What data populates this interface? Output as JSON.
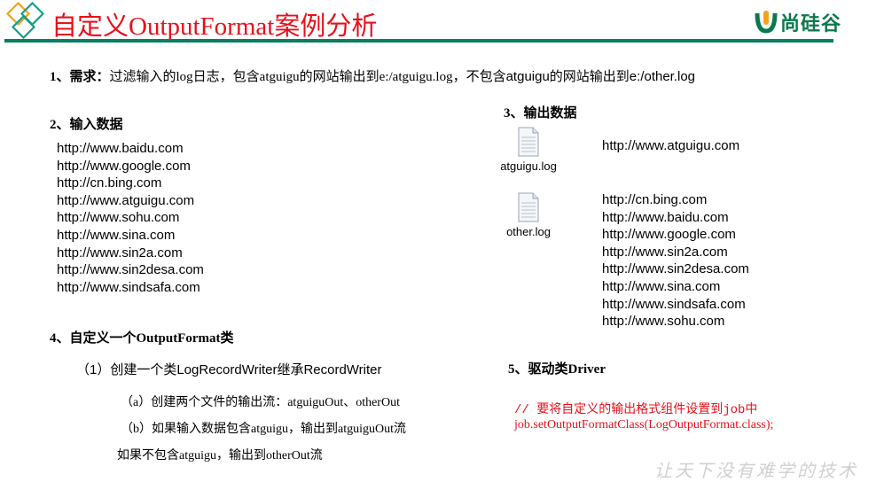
{
  "header": {
    "title": "自定义OutputFormat案例分析",
    "logo_text": "尚硅谷",
    "accent_color": "#e8101a",
    "line_color": "#0c7e62"
  },
  "requirement": {
    "label": "1、需求：",
    "text_a": "过滤输入的log日志，包含atguigu的网站输出到e:/atguigu.log，",
    "text_b": "不包含atguigu的网站输出到e:/other.log"
  },
  "input": {
    "heading": "2、输入数据",
    "urls": [
      "http://www.baidu.com",
      "http://www.google.com",
      "http://cn.bing.com",
      "http://www.atguigu.com",
      "http://www.sohu.com",
      "http://www.sina.com",
      "http://www.sin2a.com",
      "http://www.sin2desa.com",
      "http://www.sindsafa.com"
    ]
  },
  "output": {
    "heading": "3、输出数据",
    "files": [
      {
        "name": "atguigu.log",
        "icon": "text-file-icon",
        "urls": [
          "http://www.atguigu.com"
        ]
      },
      {
        "name": "other.log",
        "icon": "text-file-icon",
        "urls": [
          "http://cn.bing.com",
          "http://www.baidu.com",
          "http://www.google.com",
          "http://www.sin2a.com",
          "http://www.sin2desa.com",
          "http://www.sina.com",
          "http://www.sindsafa.com",
          "http://www.sohu.com"
        ]
      }
    ]
  },
  "custom_format": {
    "heading": "4、自定义一个OutputFormat类",
    "step1": "（1）创建一个类LogRecordWriter继承RecordWriter",
    "step_a": "（a）创建两个文件的输出流：atguiguOut、otherOut",
    "step_b": "（b）如果输入数据包含atguigu，输出到atguiguOut流",
    "step_b2": "如果不包含atguigu，输出到otherOut流"
  },
  "driver": {
    "heading": "5、驱动类Driver",
    "comment": "//  要将自定义的输出格式组件设置到job中",
    "code": "job.setOutputFormatClass(LogOutputFormat.class);"
  },
  "footer": {
    "watermark": "让天下没有难学的技术"
  }
}
